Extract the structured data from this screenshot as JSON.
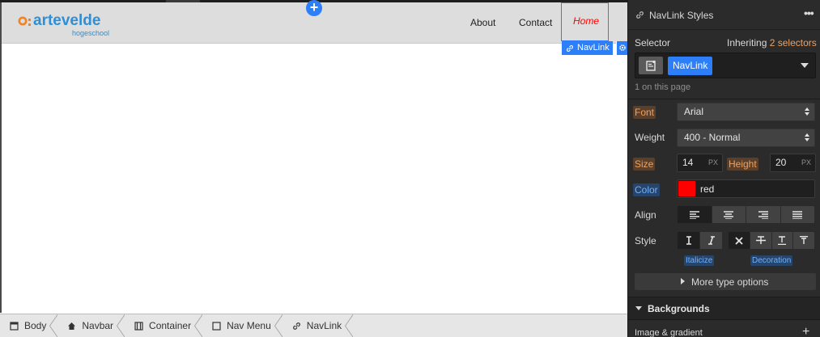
{
  "canvas": {
    "brand": {
      "name": "artevelde",
      "sub": "hogeschool"
    },
    "nav": {
      "about": "About",
      "contact": "Contact",
      "home": "Home"
    },
    "selected_badge": "NavLink",
    "add_symbol": "+"
  },
  "breadcrumb": [
    {
      "label": "Body",
      "icon": "body-icon"
    },
    {
      "label": "Navbar",
      "icon": "home-icon"
    },
    {
      "label": "Container",
      "icon": "container-icon"
    },
    {
      "label": "Nav Menu",
      "icon": "square-icon"
    },
    {
      "label": "NavLink",
      "icon": "link-icon"
    }
  ],
  "panel": {
    "title": "NavLink Styles",
    "more": "•••",
    "selector_label": "Selector",
    "inheriting_prefix": "Inheriting",
    "inheriting_count": "2 selectors",
    "selector_chip": "NavLink",
    "on_page": "1 on this page",
    "font_label": "Font",
    "font_value": "Arial",
    "weight_label": "Weight",
    "weight_value": "400 - Normal",
    "size_label": "Size",
    "size_value": "14",
    "size_unit": "PX",
    "height_label": "Height",
    "height_value": "20",
    "height_unit": "PX",
    "color_label": "Color",
    "color_value": "red",
    "color_swatch": "#ff0000",
    "align_label": "Align",
    "style_label": "Style",
    "italicize": "Italicize",
    "decoration": "Decoration",
    "more_type": "More type options",
    "backgrounds": "Backgrounds",
    "image_gradient": "Image & gradient",
    "add": "+"
  },
  "colors": {
    "accent": "#2d7ff9",
    "highlight_orange": "#f0a15d",
    "highlight_blue": "#6fb1ff",
    "logo_orange": "#f58220",
    "logo_blue": "#2e8fd6"
  }
}
